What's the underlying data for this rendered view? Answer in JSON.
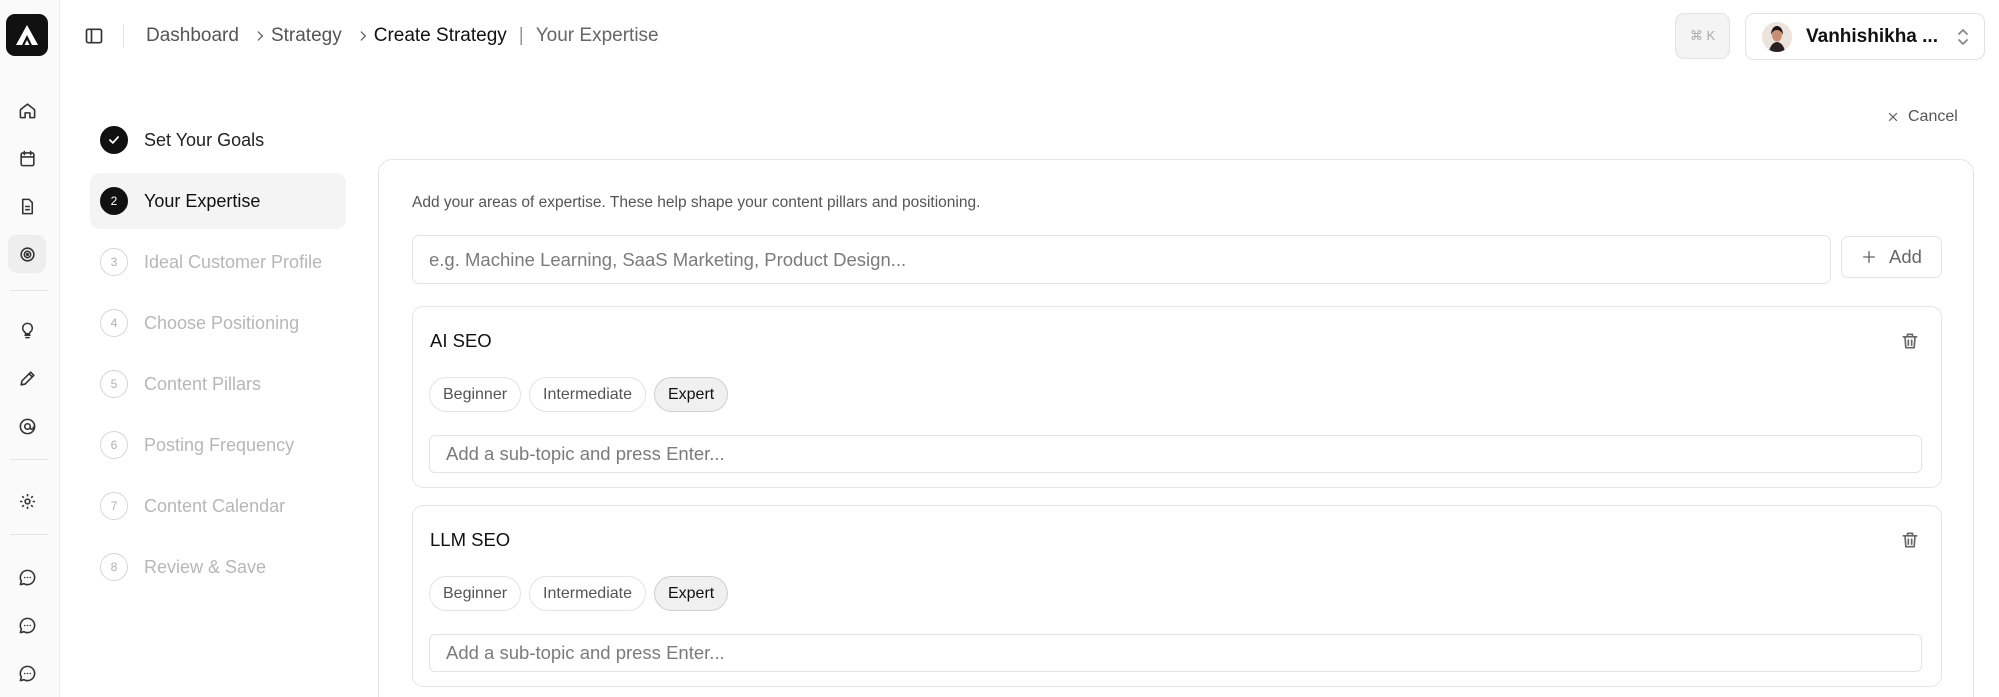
{
  "breadcrumb": {
    "items": [
      "Dashboard",
      "Strategy",
      "Create Strategy"
    ],
    "current_page": "Your Expertise"
  },
  "shortcut": "⌘ K",
  "user": {
    "name": "Vanhishikha ..."
  },
  "rail": {
    "icons": [
      "home-icon",
      "calendar-icon",
      "document-icon",
      "target-icon",
      "lightbulb-icon",
      "pencil-icon",
      "at-sign-icon",
      "settings-icon",
      "chat-icon",
      "chat-icon",
      "chat-icon"
    ],
    "active": "target-icon"
  },
  "steps": [
    {
      "number": "",
      "label": "Set Your Goals",
      "state": "done"
    },
    {
      "number": "2",
      "label": "Your Expertise",
      "state": "active"
    },
    {
      "number": "3",
      "label": "Ideal Customer Profile",
      "state": "pending"
    },
    {
      "number": "4",
      "label": "Choose Positioning",
      "state": "pending"
    },
    {
      "number": "5",
      "label": "Content Pillars",
      "state": "pending"
    },
    {
      "number": "6",
      "label": "Posting Frequency",
      "state": "pending"
    },
    {
      "number": "7",
      "label": "Content Calendar",
      "state": "pending"
    },
    {
      "number": "8",
      "label": "Review & Save",
      "state": "pending"
    }
  ],
  "cancel_label": "Cancel",
  "main": {
    "hint": "Add your areas of expertise. These help shape your content pillars and positioning.",
    "input_placeholder": "e.g. Machine Learning, SaaS Marketing, Product Design...",
    "add_label": "Add"
  },
  "levels": [
    "Beginner",
    "Intermediate",
    "Expert"
  ],
  "expertise": [
    {
      "name": "AI SEO",
      "level": "Expert",
      "subtopic_placeholder": "Add a sub-topic and press Enter..."
    },
    {
      "name": "LLM SEO",
      "level": "Expert",
      "subtopic_placeholder": "Add a sub-topic and press Enter..."
    }
  ]
}
